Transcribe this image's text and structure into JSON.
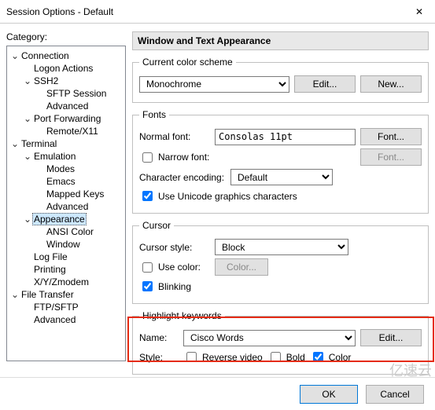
{
  "window": {
    "title": "Session Options - Default",
    "close_icon": "✕"
  },
  "category": {
    "label": "Category:",
    "tree": {
      "connection": "Connection",
      "logon_actions": "Logon Actions",
      "ssh2": "SSH2",
      "sftp_session": "SFTP Session",
      "ssh2_advanced": "Advanced",
      "port_fwd": "Port Forwarding",
      "remote_x11": "Remote/X11",
      "terminal": "Terminal",
      "emulation": "Emulation",
      "modes": "Modes",
      "emacs": "Emacs",
      "mapped_keys": "Mapped Keys",
      "emu_advanced": "Advanced",
      "appearance": "Appearance",
      "ansi_color": "ANSI Color",
      "window": "Window",
      "log_file": "Log File",
      "printing": "Printing",
      "xyz": "X/Y/Zmodem",
      "file_transfer": "File Transfer",
      "ftp_sftp": "FTP/SFTP",
      "ft_advanced": "Advanced"
    }
  },
  "main": {
    "title": "Window and Text Appearance",
    "scheme": {
      "legend": "Current color scheme",
      "value": "Monochrome",
      "edit": "Edit...",
      "new": "New..."
    },
    "fonts": {
      "legend": "Fonts",
      "normal_label": "Normal font:",
      "normal_value": "Consolas 11pt",
      "font_btn": "Font...",
      "narrow_label": "Narrow font:",
      "encoding_label": "Character encoding:",
      "encoding_value": "Default",
      "unicode_label": "Use Unicode graphics characters"
    },
    "cursor": {
      "legend": "Cursor",
      "style_label": "Cursor style:",
      "style_value": "Block",
      "use_color_label": "Use color:",
      "color_btn": "Color...",
      "blinking_label": "Blinking"
    },
    "hl": {
      "legend": "Highlight keywords",
      "name_label": "Name:",
      "name_value": "Cisco Words",
      "edit": "Edit...",
      "style_label": "Style:",
      "reverse": "Reverse video",
      "bold": "Bold",
      "color": "Color"
    }
  },
  "footer": {
    "ok": "OK",
    "cancel": "Cancel"
  },
  "watermark": "亿速云"
}
